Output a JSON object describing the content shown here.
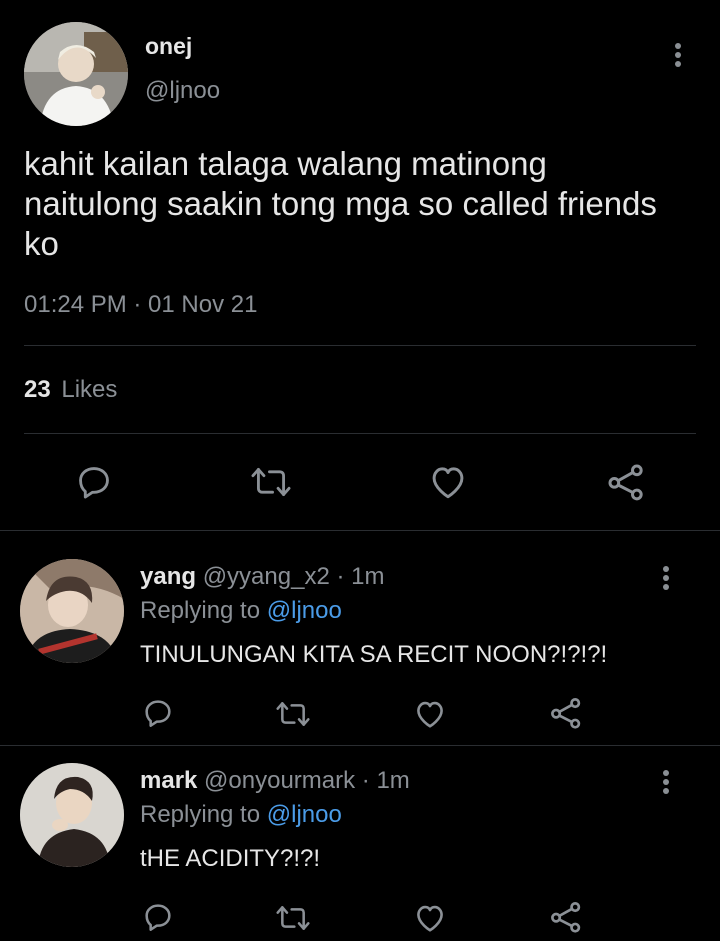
{
  "main_tweet": {
    "display_name": "onej",
    "handle": "@ljnoo",
    "text_lines": [
      "kahit kailan talaga walang matinong",
      "naitulong saakin tong mga so called friends",
      "ko"
    ],
    "timestamp": "01:24 PM · 01 Nov 21",
    "likes_count": "23",
    "likes_label": "Likes"
  },
  "replies": [
    {
      "display_name": "yang",
      "handle": "@yyang_x2",
      "time": "· 1m",
      "replying_prefix": "Replying to",
      "replying_to": "@ljnoo",
      "text": "TINULUNGAN KITA SA RECIT NOON?!?!?!"
    },
    {
      "display_name": "mark",
      "handle": "@onyourmark",
      "time": "· 1m",
      "replying_prefix": "Replying to",
      "replying_to": "@ljnoo",
      "text": "tHE ACIDITY?!?!"
    }
  ],
  "icons": [
    "more-vertical-icon",
    "reply-icon",
    "retweet-icon",
    "like-icon",
    "share-icon"
  ],
  "colors": {
    "background": "#000000",
    "text": "#d9d9d9",
    "muted": "#8b9096",
    "link": "#4b9ce8",
    "divider": "#2a2d31"
  }
}
